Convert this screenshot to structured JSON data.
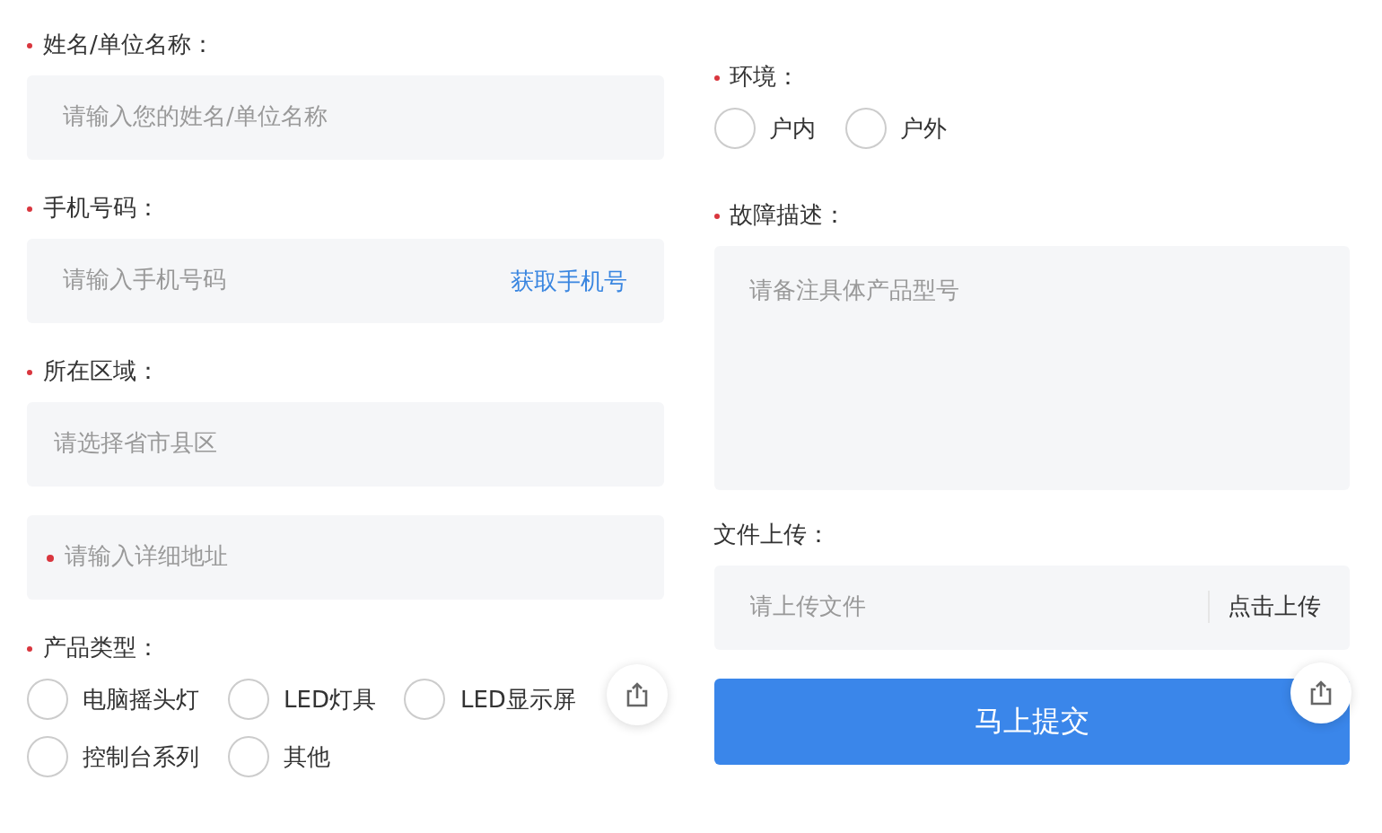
{
  "left": [
    {
      "kind": "label",
      "text": "姓名/单位名称：",
      "required": true
    },
    {
      "kind": "input",
      "placeholder": "请输入您的姓名/单位名称"
    },
    {
      "kind": "label",
      "text": "手机号码：",
      "required": true
    },
    {
      "kind": "input",
      "placeholder": "请输入手机号码",
      "action": "获取手机号"
    },
    {
      "kind": "label",
      "text": "所在区域：",
      "required": true
    },
    {
      "kind": "select",
      "placeholder": "请选择省市县区"
    },
    {
      "kind": "input",
      "placeholder": "请输入详细地址",
      "required": true
    },
    {
      "kind": "label",
      "text": "产品类型：",
      "required": true
    },
    {
      "kind": "radios",
      "options": [
        {
          "label": "电脑摇头灯",
          "selected": false
        },
        {
          "label": "LED灯具",
          "selected": false
        },
        {
          "label": "LED显示屏",
          "selected": false
        },
        {
          "label": "控制台系列",
          "selected": false
        },
        {
          "label": "其他",
          "selected": false
        }
      ]
    }
  ],
  "right": [
    {
      "kind": "label",
      "text": "环境：",
      "required": true
    },
    {
      "kind": "radios",
      "options": [
        {
          "label": "户内",
          "selected": false
        },
        {
          "label": "户外",
          "selected": false
        }
      ]
    },
    {
      "kind": "label",
      "text": "故障描述：",
      "required": true
    },
    {
      "kind": "textarea",
      "placeholder": "请备注具体产品型号"
    },
    {
      "kind": "label",
      "text": "文件上传：",
      "required": false
    },
    {
      "kind": "upload",
      "placeholder": "请上传文件",
      "action": "点击上传"
    },
    {
      "kind": "submit",
      "text": "马上提交"
    }
  ]
}
